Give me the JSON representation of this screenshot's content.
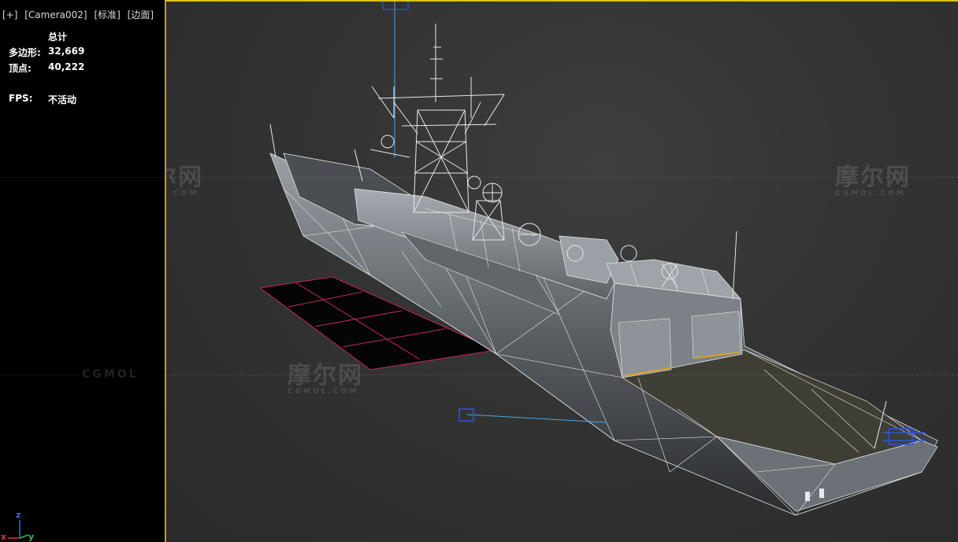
{
  "viewport": {
    "label_plus": "[+]",
    "label_camera": "[Camera002]",
    "label_shading": "[标准]",
    "label_mode": "[边面]",
    "active_border_color": "#d9c31f"
  },
  "stats": {
    "total_header": "总计",
    "polygons_label": "多边形:",
    "polygons_value": "32,669",
    "vertices_label": "顶点:",
    "vertices_value": "40,222",
    "fps_label": "FPS:",
    "fps_value": "不活动"
  },
  "watermark": {
    "text": "摩尔网",
    "subtext": "CGMOL.COM",
    "left_text": "CGMOL"
  },
  "axis_gizmo": {
    "z": "z",
    "x": "x",
    "y": "y"
  },
  "colors": {
    "wire": "#e8e8e8",
    "hull_dark": "#5a5e63",
    "hull_light": "#8a9096",
    "deck": "#3e3e35",
    "grid_line": "#c0285a",
    "camera_line": "#4aa6e8",
    "gizmo_blue": "#2d56d8"
  }
}
